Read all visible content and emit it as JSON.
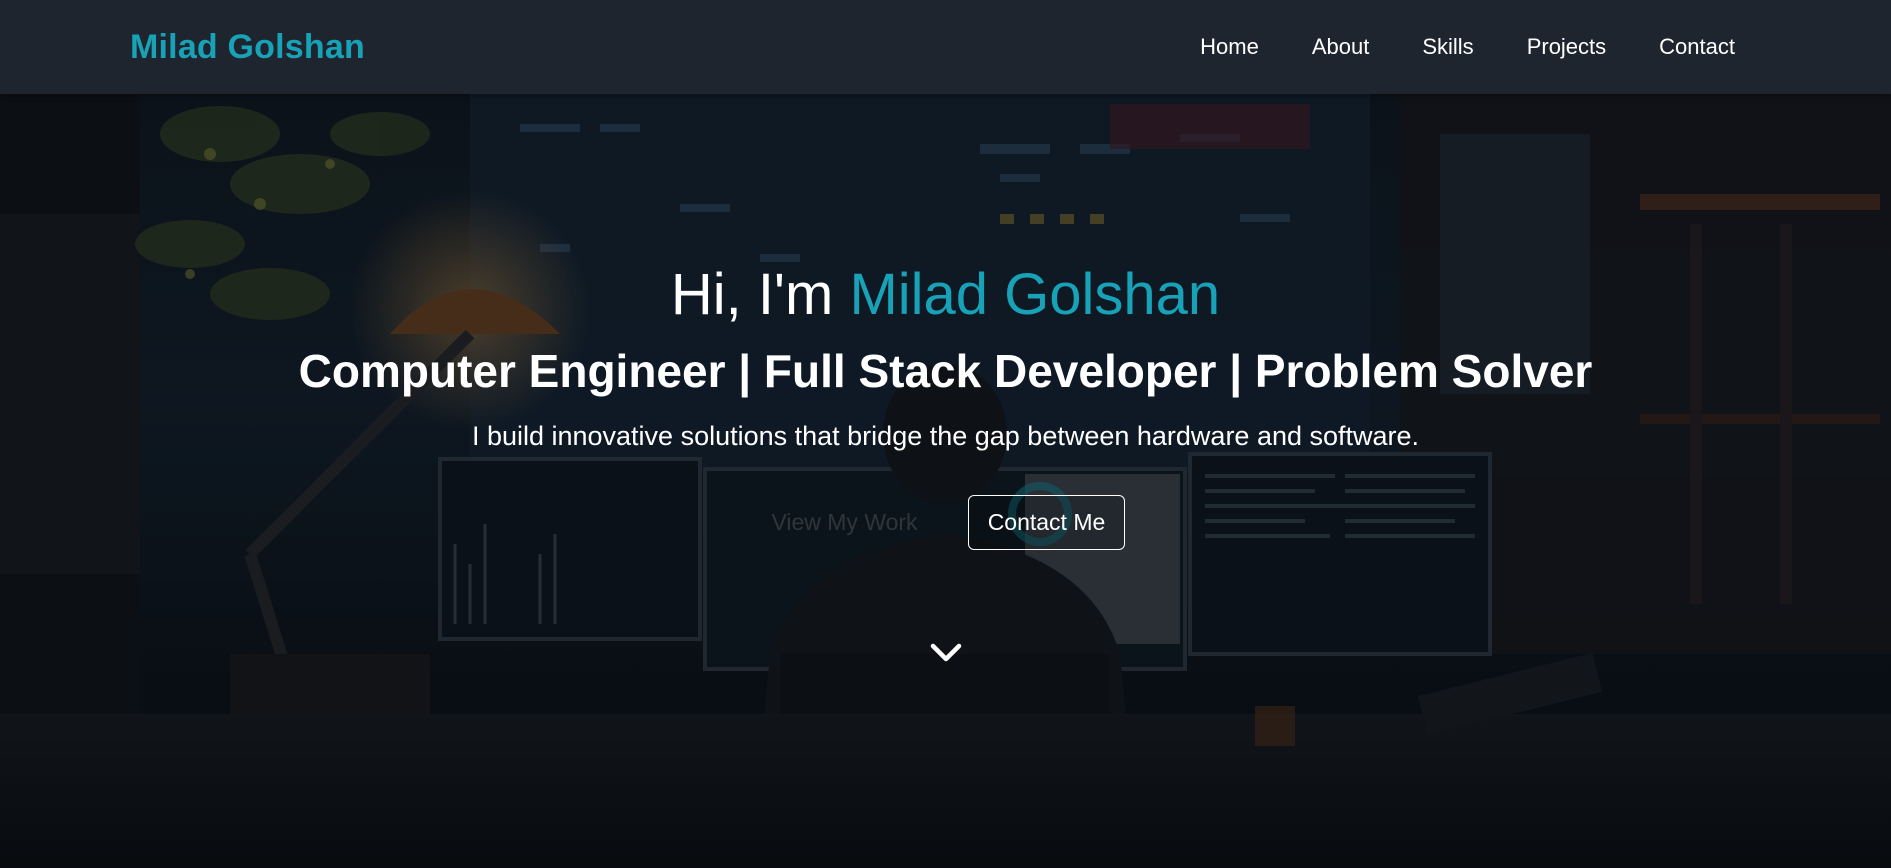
{
  "navbar": {
    "brand": "Milad Golshan",
    "links": [
      {
        "label": "Home"
      },
      {
        "label": "About"
      },
      {
        "label": "Skills"
      },
      {
        "label": "Projects"
      },
      {
        "label": "Contact"
      }
    ]
  },
  "hero": {
    "greeting": "Hi, I'm ",
    "name": "Milad Golshan",
    "subtitle": "Computer Engineer | Full Stack Developer | Problem Solver",
    "tagline": "I build innovative solutions that bridge the gap between hardware and software.",
    "buttons": {
      "view_work": "View My Work",
      "contact": "Contact Me"
    },
    "scroll_icon": "chevron-down-icon"
  },
  "colors": {
    "accent": "#17a2b8",
    "navbar_bg": "#1f252f"
  }
}
